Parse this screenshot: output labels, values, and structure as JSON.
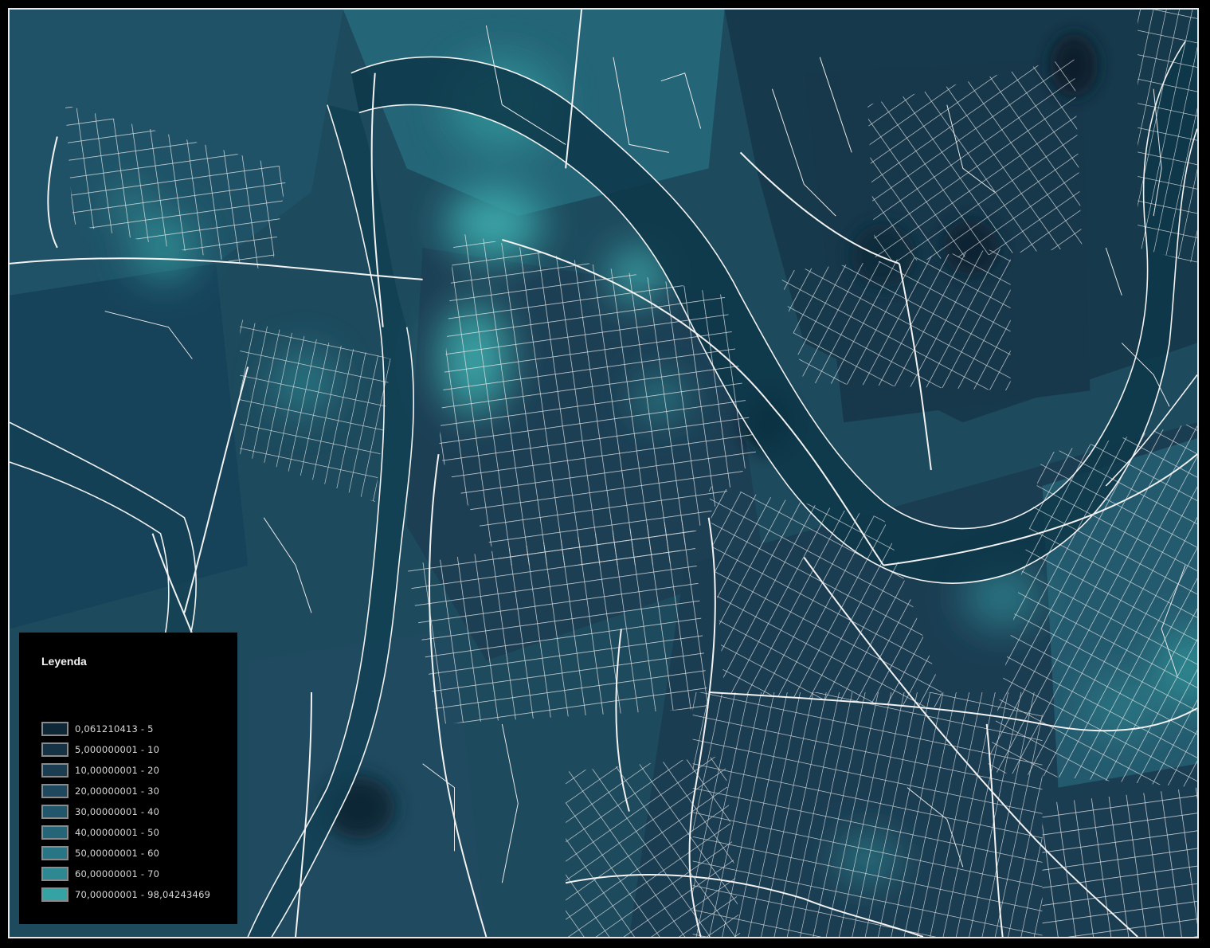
{
  "legend": {
    "title": "Leyenda",
    "classes": [
      {
        "label": "0,061210413 - 5",
        "color": "#0f2838"
      },
      {
        "label": "5,000000001 - 10",
        "color": "#163345"
      },
      {
        "label": "10,00000001 - 20",
        "color": "#1b3d52"
      },
      {
        "label": "20,00000001 - 30",
        "color": "#1f485e"
      },
      {
        "label": "30,00000001 - 40",
        "color": "#22566b"
      },
      {
        "label": "40,00000001 - 50",
        "color": "#256578"
      },
      {
        "label": "50,00000001 - 60",
        "color": "#287685"
      },
      {
        "label": "60,00000001 - 70",
        "color": "#2d8892"
      },
      {
        "label": "70,00000001 - 98,04243469",
        "color": "#35a3a4"
      }
    ]
  },
  "map": {
    "street_color": "#f0f0f0",
    "river_color": "#0d3749"
  }
}
